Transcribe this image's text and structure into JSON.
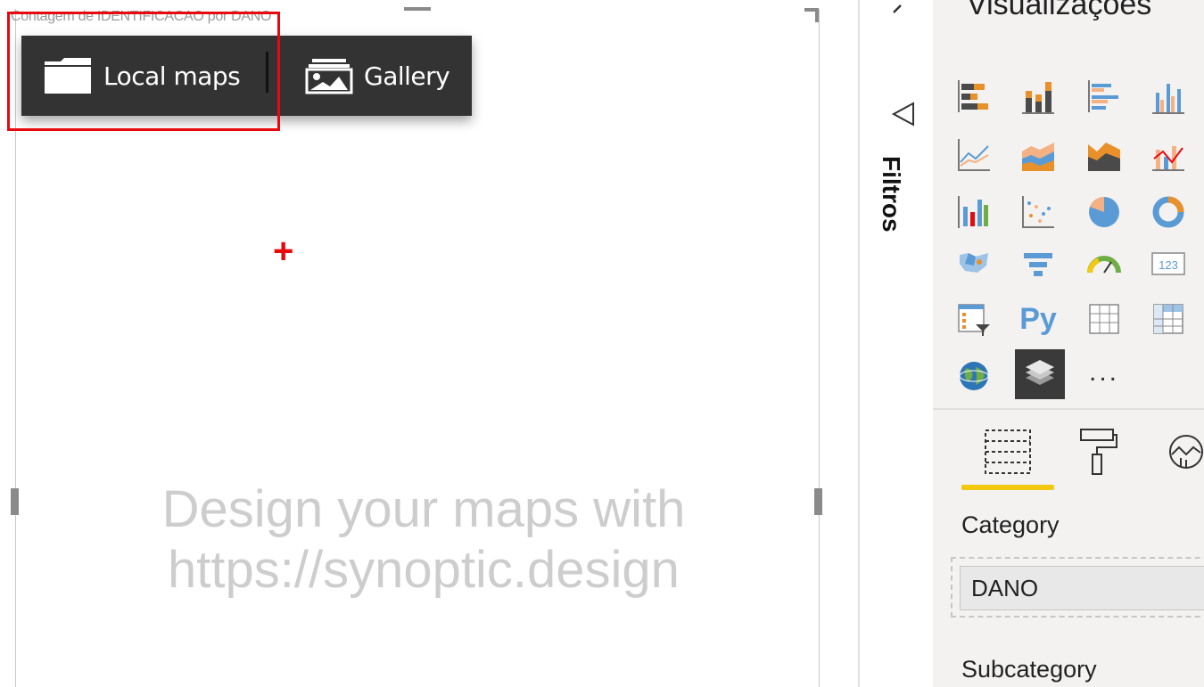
{
  "visual": {
    "title": "Contagem de IDENTIFICACAO por DANO",
    "toolbar": {
      "local_maps_label": "Local maps",
      "gallery_label": "Gallery"
    },
    "placeholder_line1": "Design your maps with",
    "placeholder_line2": "https://synoptic.design",
    "highlight_color": "#e8090f"
  },
  "filters": {
    "label": "Filtros"
  },
  "visualizations": {
    "title": "Visualizações",
    "more_label": "...",
    "icons": [
      "stacked-bar-chart-icon",
      "stacked-column-chart-icon",
      "clustered-bar-chart-icon",
      "clustered-column-chart-icon",
      "line-chart-icon",
      "area-chart-icon",
      "stacked-area-chart-icon",
      "line-and-column-chart-icon",
      "ribbon-chart-icon",
      "scatter-chart-icon",
      "pie-chart-icon",
      "donut-chart-icon",
      "map-icon",
      "funnel-chart-icon",
      "gauge-icon",
      "card-icon",
      "slicer-icon",
      "python-visual-icon",
      "table-icon",
      "matrix-icon",
      "globe-map-icon",
      "synoptic-panel-icon"
    ],
    "python_label": "Py",
    "card_label": "123",
    "tabs": [
      "fields-tab-icon",
      "format-tab-icon",
      "analytics-tab-icon"
    ],
    "category_label": "Category",
    "category_value": "DANO",
    "subcategory_label": "Subcategory",
    "accent_color": "#f2c811"
  }
}
